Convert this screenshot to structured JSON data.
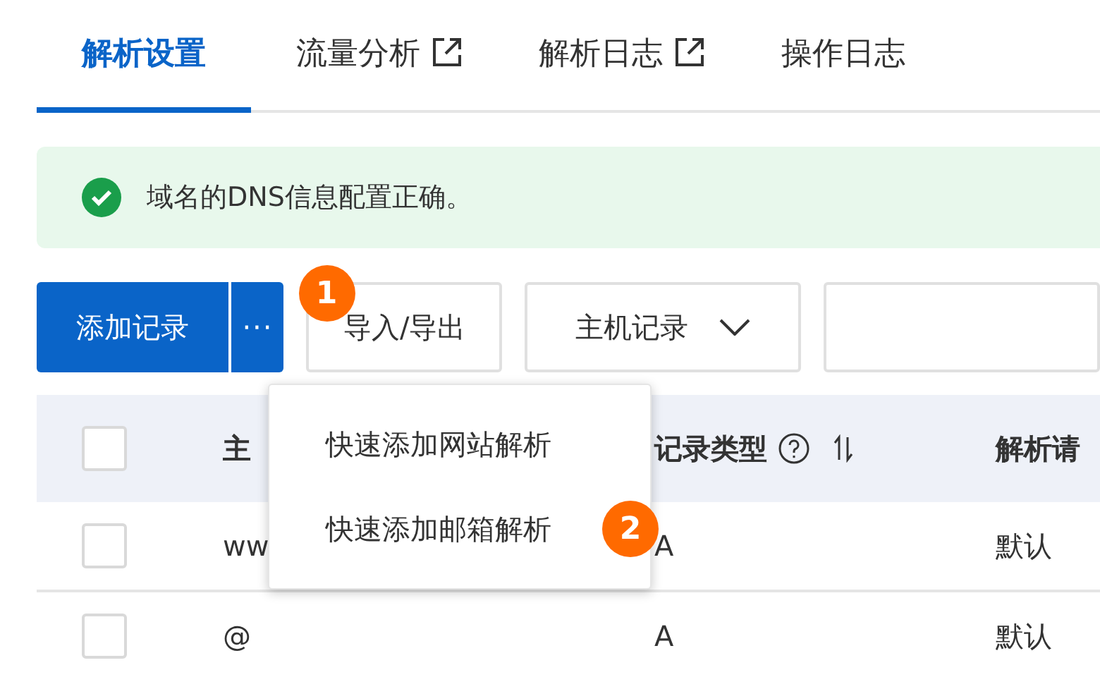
{
  "tabs": [
    {
      "label": "解析设置",
      "selected": true,
      "external": false
    },
    {
      "label": "流量分析",
      "selected": false,
      "external": true
    },
    {
      "label": "解析日志",
      "selected": false,
      "external": true
    },
    {
      "label": "操作日志",
      "selected": false,
      "external": false
    }
  ],
  "alert": {
    "kind": "success",
    "text": "域名的DNS信息配置正确。"
  },
  "toolbar": {
    "add_button": "添加记录",
    "more_button": "···",
    "more_badge": "1",
    "import_button": "导入/导出",
    "filter_select": "主机记录"
  },
  "menu": {
    "items": [
      {
        "label": "快速添加网站解析"
      },
      {
        "label": "快速添加邮箱解析",
        "badge": "2"
      }
    ]
  },
  "table": {
    "header_checked": false,
    "columns": [
      {
        "label": "主",
        "help": false,
        "sortable": false
      },
      {
        "label": "记录类型",
        "help": true,
        "sortable": true
      },
      {
        "label": "解析请",
        "help": false,
        "sortable": false
      }
    ],
    "rows": [
      {
        "checked": false,
        "cells": [
          "ww",
          "A",
          "默认"
        ]
      },
      {
        "checked": false,
        "cells": [
          "@",
          "A",
          "默认"
        ]
      }
    ]
  }
}
